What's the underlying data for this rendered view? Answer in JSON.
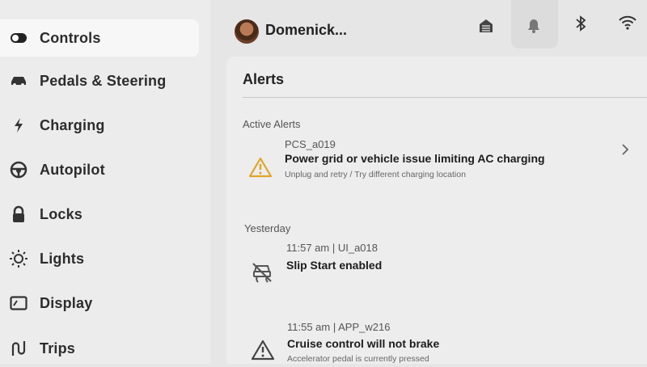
{
  "sidebar": {
    "items": [
      {
        "label": "Controls",
        "icon": "toggle-icon"
      },
      {
        "label": "Pedals & Steering",
        "icon": "car-icon"
      },
      {
        "label": "Charging",
        "icon": "lightning-icon"
      },
      {
        "label": "Autopilot",
        "icon": "steering-wheel-icon"
      },
      {
        "label": "Locks",
        "icon": "lock-icon"
      },
      {
        "label": "Lights",
        "icon": "sun-icon"
      },
      {
        "label": "Display",
        "icon": "display-icon"
      },
      {
        "label": "Trips",
        "icon": "trips-icon"
      }
    ],
    "active_index": 0
  },
  "header": {
    "user_name": "Domenick...",
    "icons": [
      "garage-icon",
      "bell-icon",
      "bluetooth-icon",
      "wifi-icon"
    ],
    "active_icon": "bell-icon"
  },
  "main": {
    "title": "Alerts",
    "sections": [
      {
        "label": "Active Alerts",
        "alerts": [
          {
            "meta": "PCS_a019",
            "message": "Power grid or vehicle issue limiting AC charging",
            "detail": "Unplug and retry / Try different charging location",
            "icon": "warning-icon",
            "icon_color": "#e0a526"
          }
        ]
      },
      {
        "label": "Yesterday",
        "alerts": [
          {
            "meta": "11:57 am | UI_a018",
            "message": "Slip Start enabled",
            "detail": "",
            "icon": "traction-off-icon"
          },
          {
            "meta": "11:55 am | APP_w216",
            "message": "Cruise control will not brake",
            "detail": "Accelerator pedal is currently pressed",
            "icon": "warning-icon"
          }
        ]
      }
    ]
  }
}
